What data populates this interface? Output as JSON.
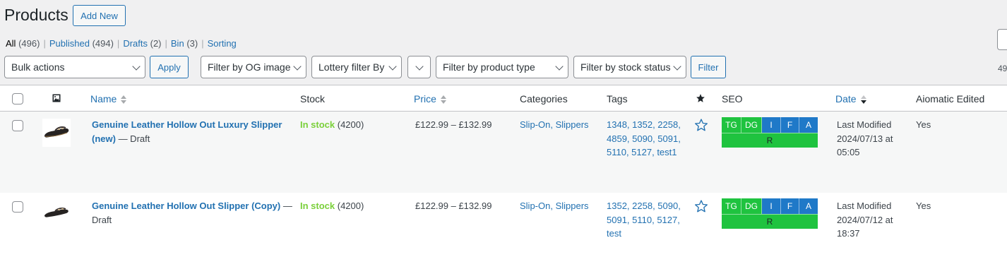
{
  "page": {
    "title": "Products",
    "add_new": "Add New"
  },
  "views": [
    {
      "label": "All",
      "count": "(496)"
    },
    {
      "label": "Published",
      "count": "(494)"
    },
    {
      "label": "Drafts",
      "count": "(2)"
    },
    {
      "label": "Bin",
      "count": "(3)"
    },
    {
      "label": "Sorting",
      "count": ""
    }
  ],
  "filters": {
    "bulk_actions": "Bulk actions",
    "apply": "Apply",
    "og_image": "Filter by OG image",
    "lottery": "Lottery filter By",
    "blank": "",
    "product_type": "Filter by product type",
    "stock_status": "Filter by stock status",
    "filter": "Filter"
  },
  "right_count": "49",
  "columns": {
    "name": "Name",
    "stock": "Stock",
    "price": "Price",
    "categories": "Categories",
    "tags": "Tags",
    "seo": "SEO",
    "date": "Date",
    "aiomatic": "Aiomatic Edited"
  },
  "rows": [
    {
      "name": "Genuine Leather Hollow Out Luxury Slipper (new)",
      "state": " — Draft",
      "stock_status": "In stock",
      "stock_qty": " (4200)",
      "price": "£122.99 – £132.99",
      "categories": "Slip-On, Slippers",
      "tags": "1348, 1352, 2258, 4859, 5090, 5091, 5110, 5127, test1",
      "seo": {
        "tg": "TG",
        "dg": "DG",
        "i": "I",
        "f": "F",
        "a": "A",
        "r": "R"
      },
      "date_label": "Last Modified",
      "date_value": "2024/07/13 at 05:05",
      "aiomatic": "Yes"
    },
    {
      "name": "Genuine Leather Hollow Out Slipper (Copy)",
      "state": " — Draft",
      "stock_status": "In stock",
      "stock_qty": " (4200)",
      "price": "£122.99 – £132.99",
      "categories": "Slip-On, Slippers",
      "tags": "1352, 2258, 5090, 5091, 5110, 5127, test",
      "seo": {
        "tg": "TG",
        "dg": "DG",
        "i": "I",
        "f": "F",
        "a": "A",
        "r": "R"
      },
      "date_label": "Last Modified",
      "date_value": "2024/07/12 at 18:37",
      "aiomatic": "Yes"
    }
  ],
  "colors": {
    "accent": "#2271b1",
    "in_stock": "#7ad03a",
    "seo_green": "#1fc33f",
    "seo_blue": "#1f79c8"
  }
}
